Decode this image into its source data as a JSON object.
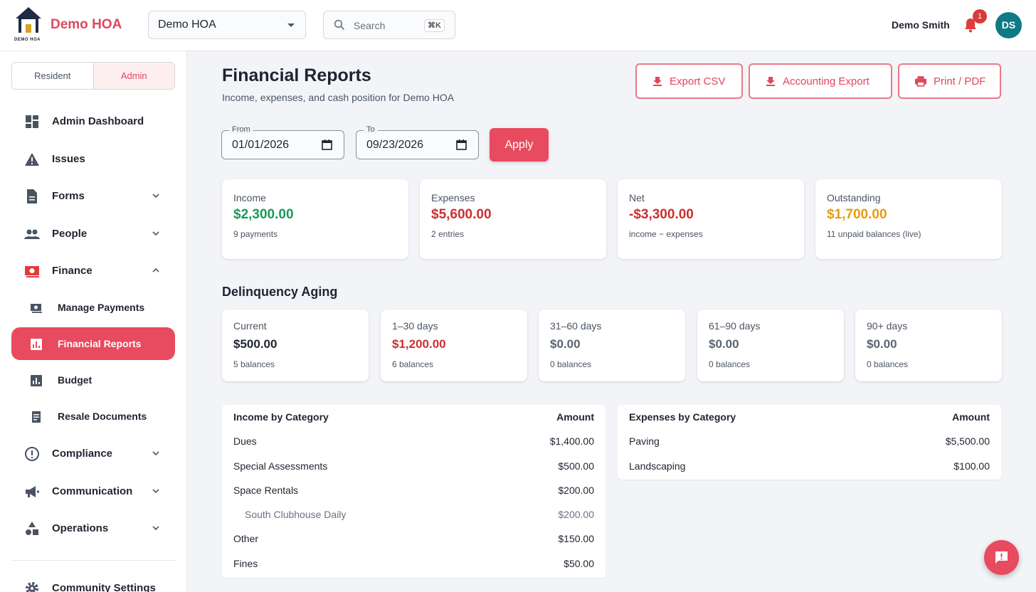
{
  "app": {
    "brand": "Demo HOA",
    "logo_caption": "DEMO HOA"
  },
  "header": {
    "hoa_select_value": "Demo HOA",
    "search_placeholder": "Search",
    "search_shortcut": "⌘K",
    "user_name": "Demo Smith",
    "notification_count": "1",
    "avatar_initials": "DS"
  },
  "sidebar": {
    "role_toggle": {
      "resident": "Resident",
      "admin": "Admin",
      "selected": "Admin"
    },
    "items": [
      {
        "label": "Admin Dashboard",
        "icon": "dashboard-icon"
      },
      {
        "label": "Issues",
        "icon": "warning-icon"
      },
      {
        "label": "Forms",
        "icon": "document-icon",
        "expandable": true
      },
      {
        "label": "People",
        "icon": "people-icon",
        "expandable": true
      },
      {
        "label": "Finance",
        "icon": "money-icon",
        "expanded": true
      },
      {
        "label": "Manage Payments",
        "icon": "payments-icon",
        "sub": true
      },
      {
        "label": "Financial Reports",
        "icon": "bar-chart-icon",
        "sub": true,
        "active": true
      },
      {
        "label": "Budget",
        "icon": "bar-chart-icon",
        "sub": true
      },
      {
        "label": "Resale Documents",
        "icon": "receipt-icon",
        "sub": true
      },
      {
        "label": "Compliance",
        "icon": "alert-circle-icon",
        "expandable": true
      },
      {
        "label": "Communication",
        "icon": "megaphone-icon",
        "expandable": true
      },
      {
        "label": "Operations",
        "icon": "shapes-icon",
        "expandable": true
      },
      {
        "label": "Community Settings",
        "icon": "gear-icon"
      }
    ]
  },
  "page": {
    "title": "Financial Reports",
    "subtitle": "Income, expenses, and cash position for Demo HOA",
    "actions": {
      "export_csv": "Export CSV",
      "accounting_export": "Accounting Export",
      "print_pdf": "Print / PDF"
    },
    "filters": {
      "from_label": "From",
      "from_value": "01/01/2026",
      "to_label": "To",
      "to_value": "09/23/2026",
      "apply": "Apply"
    }
  },
  "stats": [
    {
      "label": "Income",
      "value": "$2,300.00",
      "sub": "9 payments",
      "color": "#1a9a5a"
    },
    {
      "label": "Expenses",
      "value": "$5,600.00",
      "sub": "2 entries",
      "color": "#cc2f2f"
    },
    {
      "label": "Net",
      "value": "-$3,300.00",
      "sub": "income − expenses",
      "color": "#cc2f2f"
    },
    {
      "label": "Outstanding",
      "value": "$1,700.00",
      "sub": "11 unpaid balances (live)",
      "color": "#e89a10"
    }
  ],
  "aging": {
    "title": "Delinquency Aging",
    "buckets": [
      {
        "label": "Current",
        "value": "$500.00",
        "sub": "5 balances",
        "color": "#1f2430"
      },
      {
        "label": "1–30 days",
        "value": "$1,200.00",
        "sub": "6 balances",
        "color": "#cc2f2f"
      },
      {
        "label": "31–60 days",
        "value": "$0.00",
        "sub": "0 balances",
        "color": "#5b6472"
      },
      {
        "label": "61–90 days",
        "value": "$0.00",
        "sub": "0 balances",
        "color": "#5b6472"
      },
      {
        "label": "90+ days",
        "value": "$0.00",
        "sub": "0 balances",
        "color": "#5b6472"
      }
    ]
  },
  "income_table": {
    "headers": [
      "Income by Category",
      "Amount"
    ],
    "rows": [
      {
        "category": "Dues",
        "amount": "$1,400.00"
      },
      {
        "category": "Special Assessments",
        "amount": "$500.00"
      },
      {
        "category": "Space Rentals",
        "amount": "$200.00"
      },
      {
        "category": "South Clubhouse Daily",
        "amount": "$200.00",
        "sub": true
      },
      {
        "category": "Other",
        "amount": "$150.00"
      },
      {
        "category": "Fines",
        "amount": "$50.00"
      }
    ]
  },
  "expense_table": {
    "headers": [
      "Expenses by Category",
      "Amount"
    ],
    "rows": [
      {
        "category": "Paving",
        "amount": "$5,500.00"
      },
      {
        "category": "Landscaping",
        "amount": "$100.00"
      }
    ]
  },
  "colors": {
    "accent": "#e84a5f",
    "brand": "#e0475c",
    "avatar": "#0d7a85"
  }
}
